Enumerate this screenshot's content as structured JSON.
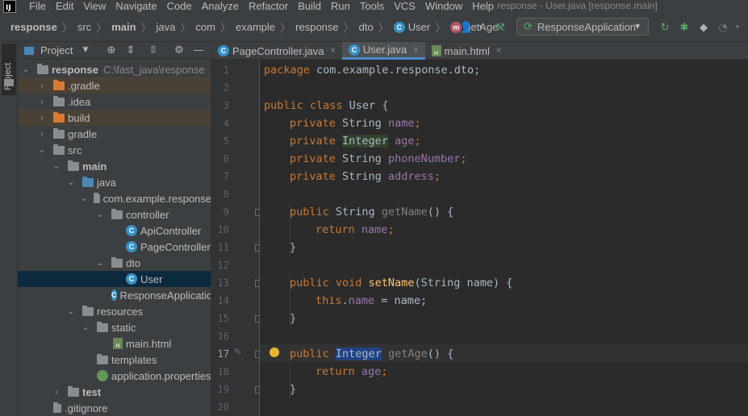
{
  "menubar": {
    "logo": "IJ",
    "items": [
      "File",
      "Edit",
      "View",
      "Navigate",
      "Code",
      "Analyze",
      "Refactor",
      "Build",
      "Run",
      "Tools",
      "VCS",
      "Window",
      "Help"
    ],
    "window_title": "response - User.java [response.main]"
  },
  "navbar": {
    "breadcrumbs": [
      "response",
      "src",
      "main",
      "java",
      "com",
      "example",
      "response",
      "dto",
      "User",
      "getAge"
    ],
    "class_badge": "C",
    "method_badge": "m",
    "run_config": "ResponseApplication"
  },
  "tool_stripe": {
    "project_label": "Project"
  },
  "project_panel": {
    "title": "Project",
    "root_name": "response",
    "root_path": "C:\\fast_java\\response",
    "items": [
      {
        "label": ".gradle"
      },
      {
        "label": ".idea"
      },
      {
        "label": "build"
      },
      {
        "label": "gradle"
      },
      {
        "label": "src"
      },
      {
        "label": "main"
      },
      {
        "label": "java"
      },
      {
        "label": "com.example.response"
      },
      {
        "label": "controller"
      },
      {
        "label": "ApiController"
      },
      {
        "label": "PageController"
      },
      {
        "label": "dto"
      },
      {
        "label": "User"
      },
      {
        "label": "ResponseApplication"
      },
      {
        "label": "resources"
      },
      {
        "label": "static"
      },
      {
        "label": "main.html"
      },
      {
        "label": "templates"
      },
      {
        "label": "application.properties"
      },
      {
        "label": "test"
      },
      {
        "label": ".gitignore"
      }
    ]
  },
  "editor": {
    "tabs": [
      {
        "label": "PageController.java",
        "active": false
      },
      {
        "label": "User.java",
        "active": true
      },
      {
        "label": "main.html",
        "active": false
      }
    ],
    "tab_close": "×",
    "line_numbers": [
      "1",
      "2",
      "3",
      "4",
      "5",
      "6",
      "7",
      "8",
      "9",
      "10",
      "11",
      "12",
      "13",
      "14",
      "15",
      "16",
      "17",
      "18",
      "19",
      "20"
    ],
    "current_line": "17",
    "code": {
      "l1_kw": "package",
      "l1_rest": " com.example.response.dto;",
      "l3_kw": "public class",
      "l3_rest": " User {",
      "l4_kw": "private",
      "l4_type": " String ",
      "l4_field": "name",
      "l4_end": ";",
      "l5_kw": "private",
      "l5_type": "Integer",
      "l5_field": "age",
      "l5_end": ";",
      "l6_kw": "private",
      "l6_type": " String ",
      "l6_field": "phoneNumber",
      "l6_end": ";",
      "l7_kw": "private",
      "l7_type": " String ",
      "l7_field": "address",
      "l7_end": ";",
      "l9_kw": "public",
      "l9_type": " String ",
      "l9_method": "getName",
      "l9_end": "() {",
      "l10_kw": "return",
      "l10_field": "name",
      "l10_end": ";",
      "l11": "}",
      "l13_kw": "public void",
      "l13_method": "setName",
      "l13_end": "(String name) {",
      "l14_kw": "this",
      "l14_dot": ".",
      "l14_field": "name",
      "l14_end": " = name;",
      "l15": "}",
      "l17_kw": "public",
      "l17_type": "Integer",
      "l17_method": "getAge",
      "l17_end": "() {",
      "l18_kw": "return",
      "l18_field": "age",
      "l18_end": ";",
      "l19": "}"
    }
  }
}
